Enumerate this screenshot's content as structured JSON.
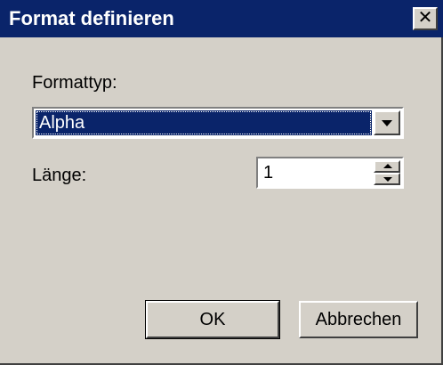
{
  "window": {
    "title": "Format definieren",
    "close_glyph": "✕"
  },
  "form": {
    "format_type_label": "Formattyp:",
    "format_type_value": "Alpha",
    "length_label": "Länge:",
    "length_value": "1"
  },
  "buttons": {
    "ok_label": "OK",
    "cancel_label": "Abbrechen"
  },
  "icons": {
    "close": "close-icon",
    "dropdown": "chevron-down-icon",
    "spin_up": "spin-up-icon",
    "spin_down": "spin-down-icon"
  },
  "colors": {
    "titlebar": "#0a246a",
    "dialog_bg": "#d4d0c8",
    "selection": "#0a246a"
  }
}
